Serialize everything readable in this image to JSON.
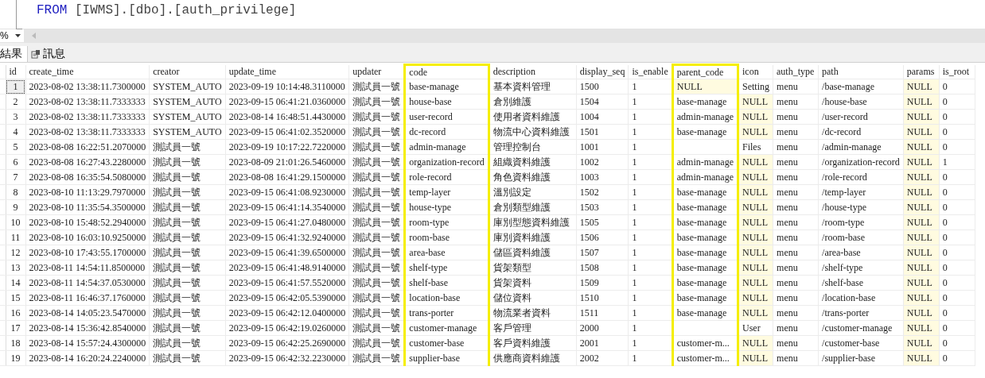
{
  "editor": {
    "keyword": "FROM",
    "statement": "[IWMS].[dbo].[auth_privilege]"
  },
  "toolbar": {
    "zoom": "%"
  },
  "tabs": [
    {
      "label": "結果",
      "kind": "grid",
      "selected": true
    },
    {
      "label": "訊息",
      "kind": "messages",
      "selected": false
    }
  ],
  "table": {
    "columns": [
      {
        "label": "id",
        "highlighted": false
      },
      {
        "label": "create_time",
        "highlighted": false
      },
      {
        "label": "creator",
        "highlighted": false
      },
      {
        "label": "update_time",
        "highlighted": false
      },
      {
        "label": "updater",
        "highlighted": false
      },
      {
        "label": "code",
        "highlighted": true
      },
      {
        "label": "description",
        "highlighted": false
      },
      {
        "label": "display_seq",
        "highlighted": false
      },
      {
        "label": "is_enable",
        "highlighted": false
      },
      {
        "label": "parent_code",
        "highlighted": true
      },
      {
        "label": "icon",
        "highlighted": false
      },
      {
        "label": "auth_type",
        "highlighted": false
      },
      {
        "label": "path",
        "highlighted": false
      },
      {
        "label": "params",
        "highlighted": false
      },
      {
        "label": "is_root",
        "highlighted": false
      }
    ],
    "rows": [
      {
        "current": true,
        "cells": [
          "1",
          "2023-08-02 13:38:11.7300000",
          "SYSTEM_AUTO",
          "2023-09-19 10:14:48.3110000",
          "測試員一號",
          "base-manage",
          "基本資料管理",
          "1500",
          "1",
          {
            "value": "NULL",
            "null": true
          },
          "Setting",
          "menu",
          "/base-manage",
          {
            "value": "NULL",
            "null": true
          },
          "0"
        ]
      },
      {
        "current": false,
        "cells": [
          "2",
          "2023-08-02 13:38:11.7333333",
          "SYSTEM_AUTO",
          "2023-09-15 06:41:21.0360000",
          "測試員一號",
          "house-base",
          "倉別維護",
          "1504",
          "1",
          "base-manage",
          {
            "value": "NULL",
            "null": true
          },
          "menu",
          "/house-base",
          {
            "value": "NULL",
            "null": true
          },
          "0"
        ]
      },
      {
        "current": false,
        "cells": [
          "3",
          "2023-08-02 13:38:11.7333333",
          "SYSTEM_AUTO",
          "2023-08-14 16:48:51.4430000",
          "測試員一號",
          "user-record",
          "使用者資料維護",
          "1004",
          "1",
          "admin-manage",
          {
            "value": "NULL",
            "null": true
          },
          "menu",
          "/user-record",
          {
            "value": "NULL",
            "null": true
          },
          "0"
        ]
      },
      {
        "current": false,
        "cells": [
          "4",
          "2023-08-02 13:38:11.7333333",
          "SYSTEM_AUTO",
          "2023-09-15 06:41:02.3520000",
          "測試員一號",
          "dc-record",
          "物流中心資料維護",
          "1501",
          "1",
          "base-manage",
          {
            "value": "NULL",
            "null": true
          },
          "menu",
          "/dc-record",
          {
            "value": "NULL",
            "null": true
          },
          "0"
        ]
      },
      {
        "current": false,
        "cells": [
          "5",
          "2023-08-08 16:22:51.2070000",
          "測試員一號",
          "2023-09-19 10:17:22.7220000",
          "測試員一號",
          "admin-manage",
          "管理控制台",
          "1001",
          "1",
          null,
          "Files",
          "menu",
          "/admin-manage",
          {
            "value": "NULL",
            "null": true
          },
          "0"
        ]
      },
      {
        "current": false,
        "cells": [
          "6",
          "2023-08-08 16:27:43.2280000",
          "測試員一號",
          "2023-08-09 21:01:26.5460000",
          "測試員一號",
          "organization-record",
          "組織資料維護",
          "1002",
          "1",
          "admin-manage",
          {
            "value": "NULL",
            "null": true
          },
          "menu",
          "/organization-record",
          {
            "value": "NULL",
            "null": true
          },
          "1"
        ]
      },
      {
        "current": false,
        "cells": [
          "7",
          "2023-08-08 16:35:54.5080000",
          "測試員一號",
          "2023-08-08 16:41:29.1500000",
          "測試員一號",
          "role-record",
          "角色資料維護",
          "1003",
          "1",
          "admin-manage",
          {
            "value": "NULL",
            "null": true
          },
          "menu",
          "/role-record",
          {
            "value": "NULL",
            "null": true
          },
          "0"
        ]
      },
      {
        "current": false,
        "cells": [
          "8",
          "2023-08-10 11:13:29.7970000",
          "測試員一號",
          "2023-09-15 06:41:08.9230000",
          "測試員一號",
          "temp-layer",
          "溫別設定",
          "1502",
          "1",
          "base-manage",
          {
            "value": "NULL",
            "null": true
          },
          "menu",
          "/temp-layer",
          {
            "value": "NULL",
            "null": true
          },
          "0"
        ]
      },
      {
        "current": false,
        "cells": [
          "9",
          "2023-08-10 11:35:54.3500000",
          "測試員一號",
          "2023-09-15 06:41:14.3540000",
          "測試員一號",
          "house-type",
          "倉別類型維護",
          "1503",
          "1",
          "base-manage",
          {
            "value": "NULL",
            "null": true
          },
          "menu",
          "/house-type",
          {
            "value": "NULL",
            "null": true
          },
          "0"
        ]
      },
      {
        "current": false,
        "cells": [
          "10",
          "2023-08-10 15:48:52.2940000",
          "測試員一號",
          "2023-09-15 06:41:27.0480000",
          "測試員一號",
          "room-type",
          "庫別型態資料維護",
          "1505",
          "1",
          "base-manage",
          {
            "value": "NULL",
            "null": true
          },
          "menu",
          "/room-type",
          {
            "value": "NULL",
            "null": true
          },
          "0"
        ]
      },
      {
        "current": false,
        "cells": [
          "11",
          "2023-08-10 16:03:10.9250000",
          "測試員一號",
          "2023-09-15 06:41:32.9240000",
          "測試員一號",
          "room-base",
          "庫別資料維護",
          "1506",
          "1",
          "base-manage",
          {
            "value": "NULL",
            "null": true
          },
          "menu",
          "/room-base",
          {
            "value": "NULL",
            "null": true
          },
          "0"
        ]
      },
      {
        "current": false,
        "cells": [
          "12",
          "2023-08-10 17:43:55.1700000",
          "測試員一號",
          "2023-09-15 06:41:39.6500000",
          "測試員一號",
          "area-base",
          "儲區資料維護",
          "1507",
          "1",
          "base-manage",
          {
            "value": "NULL",
            "null": true
          },
          "menu",
          "/area-base",
          {
            "value": "NULL",
            "null": true
          },
          "0"
        ]
      },
      {
        "current": false,
        "cells": [
          "13",
          "2023-08-11 14:54:11.8500000",
          "測試員一號",
          "2023-09-15 06:41:48.9140000",
          "測試員一號",
          "shelf-type",
          "貨架類型",
          "1508",
          "1",
          "base-manage",
          {
            "value": "NULL",
            "null": true
          },
          "menu",
          "/shelf-type",
          {
            "value": "NULL",
            "null": true
          },
          "0"
        ]
      },
      {
        "current": false,
        "cells": [
          "14",
          "2023-08-11 14:54:37.0530000",
          "測試員一號",
          "2023-09-15 06:41:57.5520000",
          "測試員一號",
          "shelf-base",
          "貨架資料",
          "1509",
          "1",
          "base-manage",
          {
            "value": "NULL",
            "null": true
          },
          "menu",
          "/shelf-base",
          {
            "value": "NULL",
            "null": true
          },
          "0"
        ]
      },
      {
        "current": false,
        "cells": [
          "15",
          "2023-08-11 16:46:37.1760000",
          "測試員一號",
          "2023-09-15 06:42:05.5390000",
          "測試員一號",
          "location-base",
          "儲位資料",
          "1510",
          "1",
          "base-manage",
          {
            "value": "NULL",
            "null": true
          },
          "menu",
          "/location-base",
          {
            "value": "NULL",
            "null": true
          },
          "0"
        ]
      },
      {
        "current": false,
        "cells": [
          "16",
          "2023-08-14 14:05:23.5470000",
          "測試員一號",
          "2023-09-15 06:42:12.0400000",
          "測試員一號",
          "trans-porter",
          "物流業者資料",
          "1511",
          "1",
          "base-manage",
          {
            "value": "NULL",
            "null": true
          },
          "menu",
          "/trans-porter",
          {
            "value": "NULL",
            "null": true
          },
          "0"
        ]
      },
      {
        "current": false,
        "cells": [
          "17",
          "2023-08-14 15:36:42.8540000",
          "測試員一號",
          "2023-09-15 06:42:19.0260000",
          "測試員一號",
          "customer-manage",
          "客戶管理",
          "2000",
          "1",
          null,
          "User",
          "menu",
          "/customer-manage",
          {
            "value": "NULL",
            "null": true
          },
          "0"
        ]
      },
      {
        "current": false,
        "cells": [
          "18",
          "2023-08-14 15:57:24.4300000",
          "測試員一號",
          "2023-09-15 06:42:25.2690000",
          "測試員一號",
          "customer-base",
          "客戶資料維護",
          "2001",
          "1",
          "customer-m...",
          {
            "value": "NULL",
            "null": true
          },
          "menu",
          "/customer-base",
          {
            "value": "NULL",
            "null": true
          },
          "0"
        ]
      },
      {
        "current": false,
        "cells": [
          "19",
          "2023-08-14 16:20:24.2240000",
          "測試員一號",
          "2023-09-15 06:42:32.2230000",
          "測試員一號",
          "supplier-base",
          "供應商資料維護",
          "2002",
          "1",
          "customer-m...",
          {
            "value": "NULL",
            "null": true
          },
          "menu",
          "/supplier-base",
          {
            "value": "NULL",
            "null": true
          },
          "0"
        ]
      }
    ]
  }
}
